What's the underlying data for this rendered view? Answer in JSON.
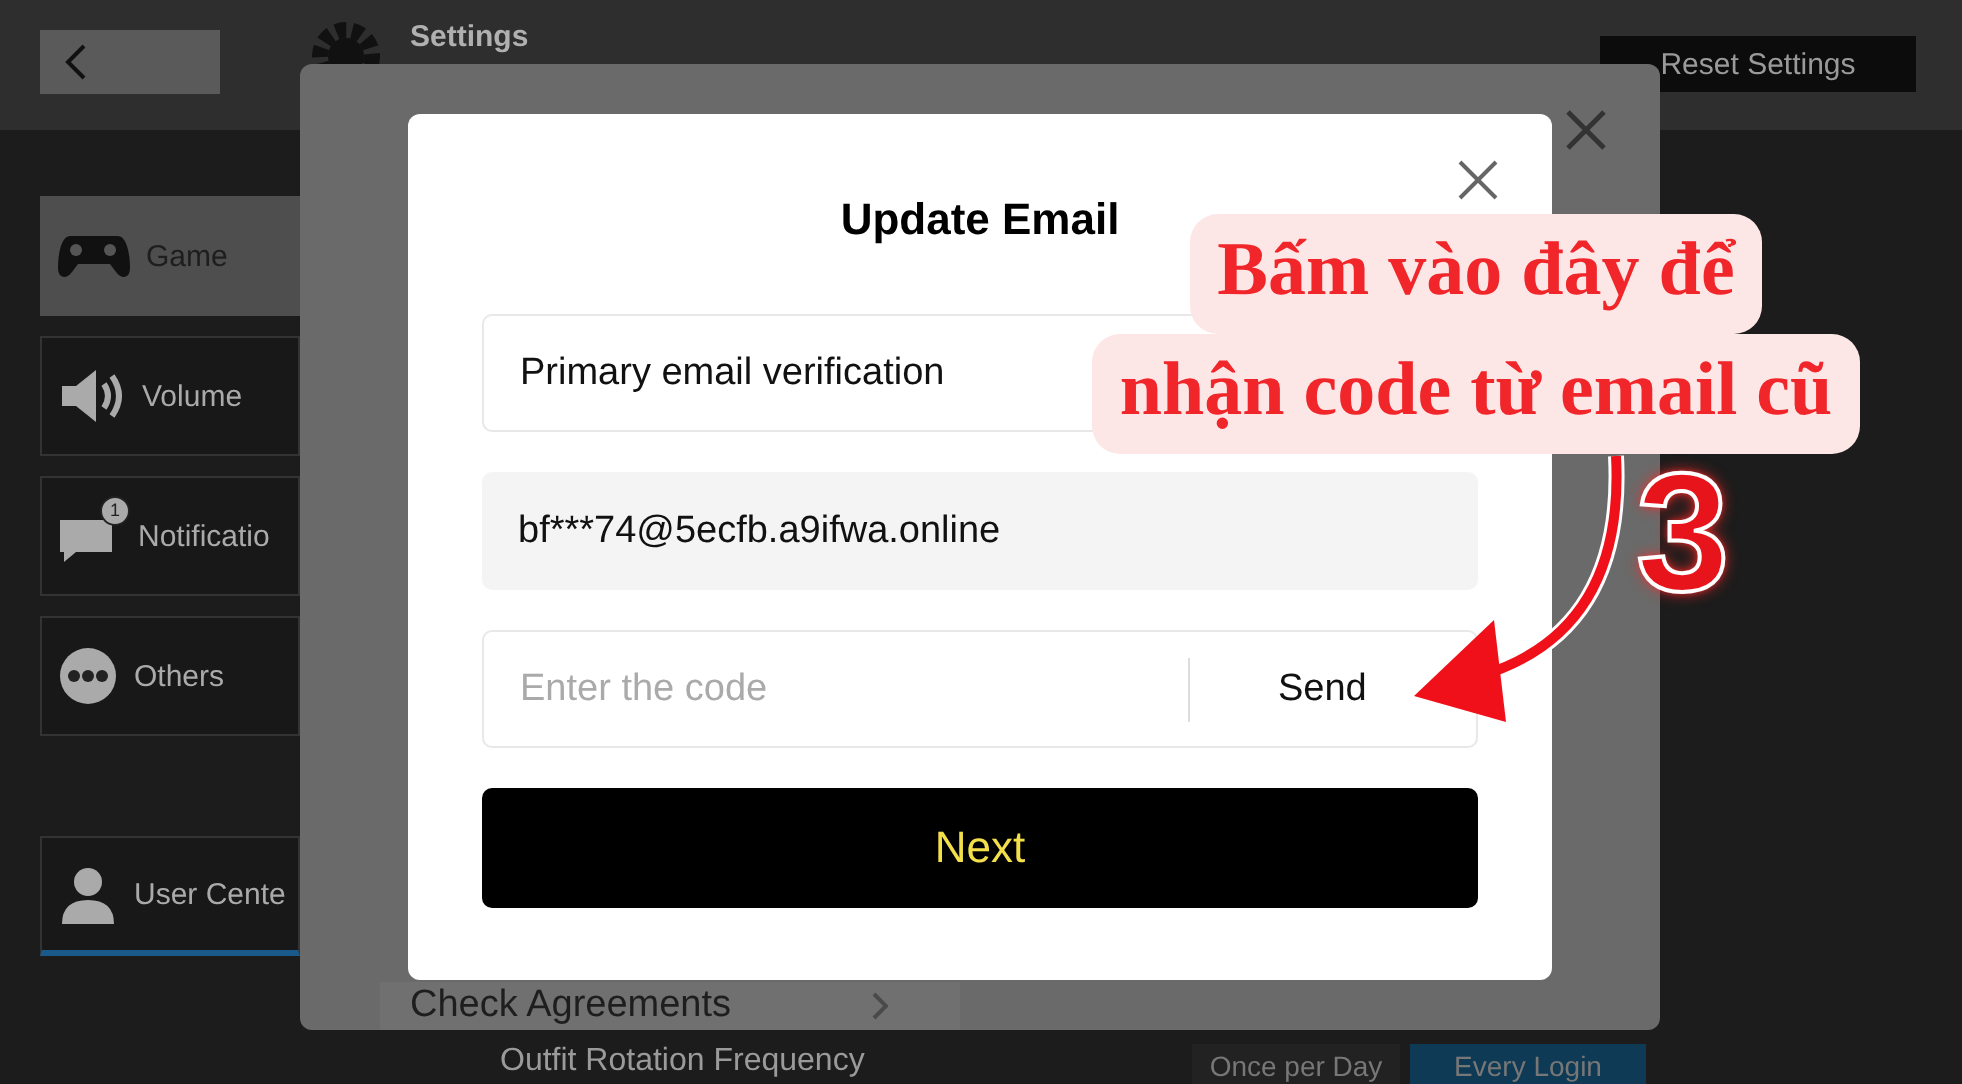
{
  "background": {
    "title": "Settings",
    "reset_button": "Reset Settings",
    "sidebar": [
      {
        "label": "Game",
        "selected": true
      },
      {
        "label": "Volume",
        "selected": false
      },
      {
        "label": "Notificatio",
        "selected": false,
        "badge": "1"
      },
      {
        "label": "Others",
        "selected": false
      },
      {
        "label": "User Cente",
        "selected": false
      }
    ],
    "setting_label": "Outfit Rotation Frequency",
    "options": [
      {
        "label": "Once per Day",
        "selected": false
      },
      {
        "label": "Every Login",
        "selected": true
      }
    ]
  },
  "panel": {
    "link": "Check Agreements"
  },
  "dialog": {
    "title": "Update Email",
    "fields": [
      {
        "kind": "select",
        "value": "Primary email verification"
      },
      {
        "kind": "readonly",
        "value": "bf***74@5ecfb.a9ifwa.online"
      },
      {
        "kind": "code",
        "placeholder": "Enter the code",
        "action": "Send"
      }
    ],
    "button": "Next"
  },
  "annotation": {
    "lines": [
      "Bấm vào đây để",
      "nhận code từ email cũ"
    ],
    "step": "3"
  }
}
